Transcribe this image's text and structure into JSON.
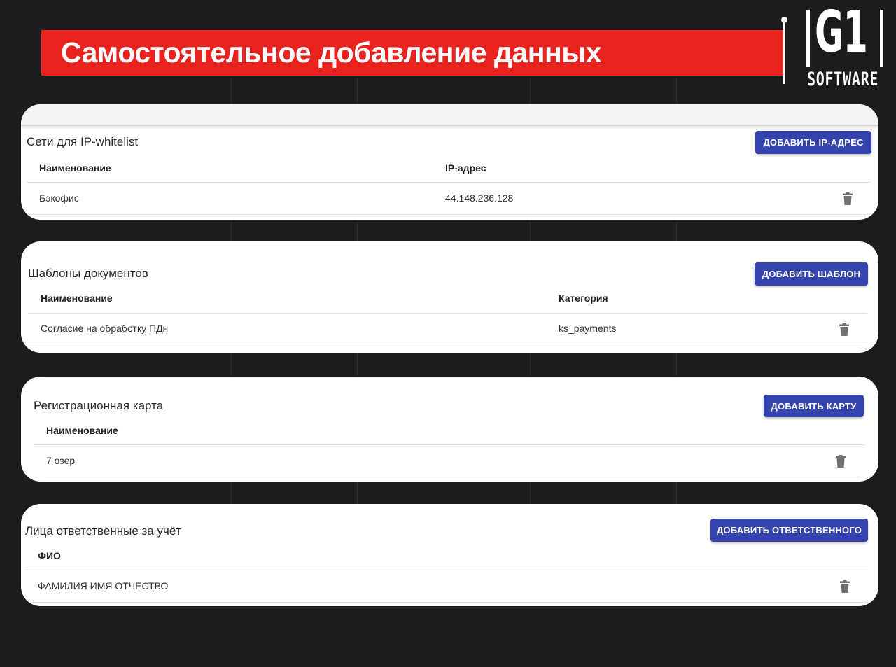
{
  "header": {
    "title": "Самостоятельное добавление данных",
    "logo_mark": "G1",
    "logo_sub": "SOFTWARE"
  },
  "cards": [
    {
      "title": "Сети для IP-whitelist",
      "button_label": "ДОБАВИТЬ IP-АДРЕС",
      "columns": [
        "Наименование",
        "IP-адрес"
      ],
      "rows": [
        [
          "Бэкофис",
          "44.148.236.128"
        ]
      ]
    },
    {
      "title": "Шаблоны документов",
      "button_label": "ДОБАВИТЬ ШАБЛОН",
      "columns": [
        "Наименование",
        "Категория"
      ],
      "rows": [
        [
          "Согласие на обработку ПДн",
          "ks_payments"
        ]
      ]
    },
    {
      "title": "Регистрационная карта",
      "button_label": "ДОБАВИТЬ КАРТУ",
      "columns": [
        "Наименование"
      ],
      "rows": [
        [
          "7 озер"
        ]
      ]
    },
    {
      "title": "Лица ответственные за учёт",
      "button_label": "ДОБАВИТЬ ОТВЕТСТВЕННОГО",
      "columns": [
        "ФИО"
      ],
      "rows": [
        [
          "ФАМИЛИЯ ИМЯ ОТЧЕСТВО"
        ]
      ]
    }
  ],
  "icons": {
    "delete": "trash-icon"
  },
  "colors": {
    "banner": "#e8231f",
    "button": "#3443ad",
    "background": "#1c1c1e"
  }
}
